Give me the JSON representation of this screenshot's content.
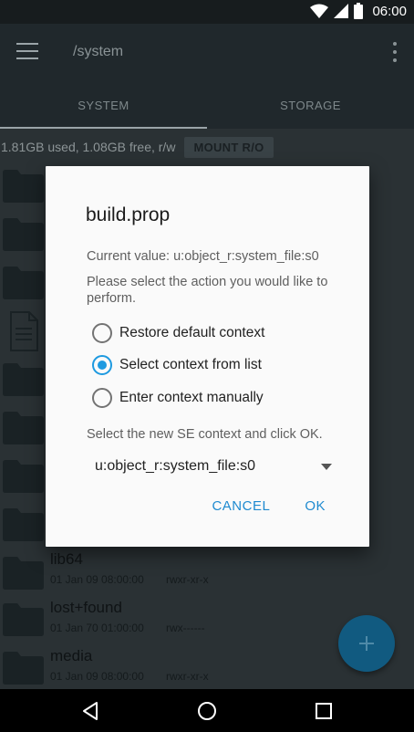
{
  "status_bar": {
    "time": "06:00",
    "icons": [
      "wifi-icon",
      "signal-icon",
      "battery-icon"
    ]
  },
  "app_bar": {
    "path": "/system",
    "tabs": [
      {
        "label": "SYSTEM",
        "active": true
      },
      {
        "label": "STORAGE",
        "active": false
      }
    ]
  },
  "info_bar": {
    "text": "1.81GB used, 1.08GB free, r/w",
    "mount_button": "MOUNT R/O"
  },
  "files": [
    {
      "name": "lib64",
      "date": "01 Jan 09 08:00:00",
      "perm": "rwxr-xr-x"
    },
    {
      "name": "lost+found",
      "date": "01 Jan 70 01:00:00",
      "perm": "rwx------"
    },
    {
      "name": "media",
      "date": "01 Jan 09 08:00:00",
      "perm": "rwxr-xr-x"
    }
  ],
  "dialog": {
    "title": "build.prop",
    "current_value": "Current value: u:object_r:system_file:s0",
    "prompt": "Please select the action you would like to perform.",
    "options": [
      {
        "label": "Restore default context",
        "checked": false
      },
      {
        "label": "Select context from list",
        "checked": true
      },
      {
        "label": "Enter context manually",
        "checked": false
      }
    ],
    "select_hint": "Select the new SE context and click OK.",
    "dropdown_value": "u:object_r:system_file:s0",
    "cancel_label": "CANCEL",
    "ok_label": "OK"
  },
  "colors": {
    "accent": "#1e9ae0",
    "fab": "#115a80"
  }
}
